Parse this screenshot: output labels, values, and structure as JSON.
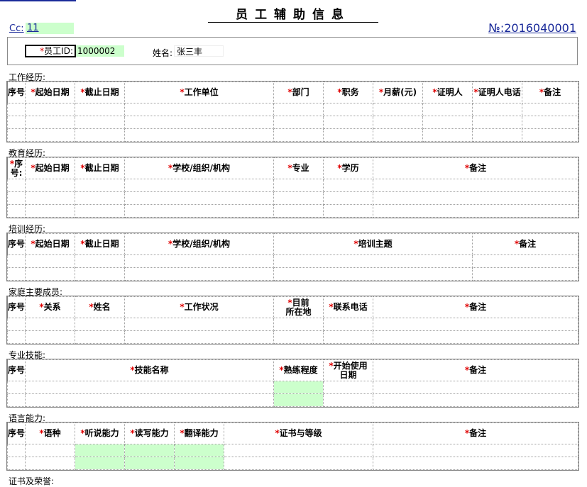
{
  "header": {
    "title": "员工辅助信息",
    "cc_label": "Cc:",
    "cc_value": "11",
    "doc_no": "№:2016040001"
  },
  "employee": {
    "id_label": "员工ID:",
    "id_value": "1000002",
    "name_label": "姓名:",
    "name_value": "张三丰"
  },
  "sections": {
    "work": {
      "label": "工作经历:",
      "columns": [
        "序号",
        "起始日期",
        "截止日期",
        "工作单位",
        "部门",
        "职务",
        "月薪(元)",
        "证明人",
        "证明人电话",
        "备注"
      ]
    },
    "education": {
      "label": "教育经历:",
      "columns": [
        "序号:",
        "起始日期",
        "截止日期",
        "学校/组织/机构",
        "专业",
        "学历",
        "备注"
      ]
    },
    "training": {
      "label": "培训经历:",
      "columns": [
        "序号",
        "起始日期",
        "截止日期",
        "学校/组织/机构",
        "培训主题",
        "备注"
      ]
    },
    "family": {
      "label": "家庭主要成员:",
      "columns": [
        "序号",
        "关系",
        "姓名",
        "工作状况",
        "目前所在地",
        "联系电话",
        "备注"
      ]
    },
    "skills": {
      "label": "专业技能:",
      "columns": [
        "序号",
        "技能名称",
        "熟练程度",
        "开始使用日期",
        "备注"
      ]
    },
    "language": {
      "label": "语言能力:",
      "columns": [
        "序号",
        "语种",
        "听说能力",
        "读写能力",
        "翻译能力",
        "证书与等级",
        "备注"
      ]
    },
    "cert": {
      "label": "证书及荣誉:"
    }
  }
}
